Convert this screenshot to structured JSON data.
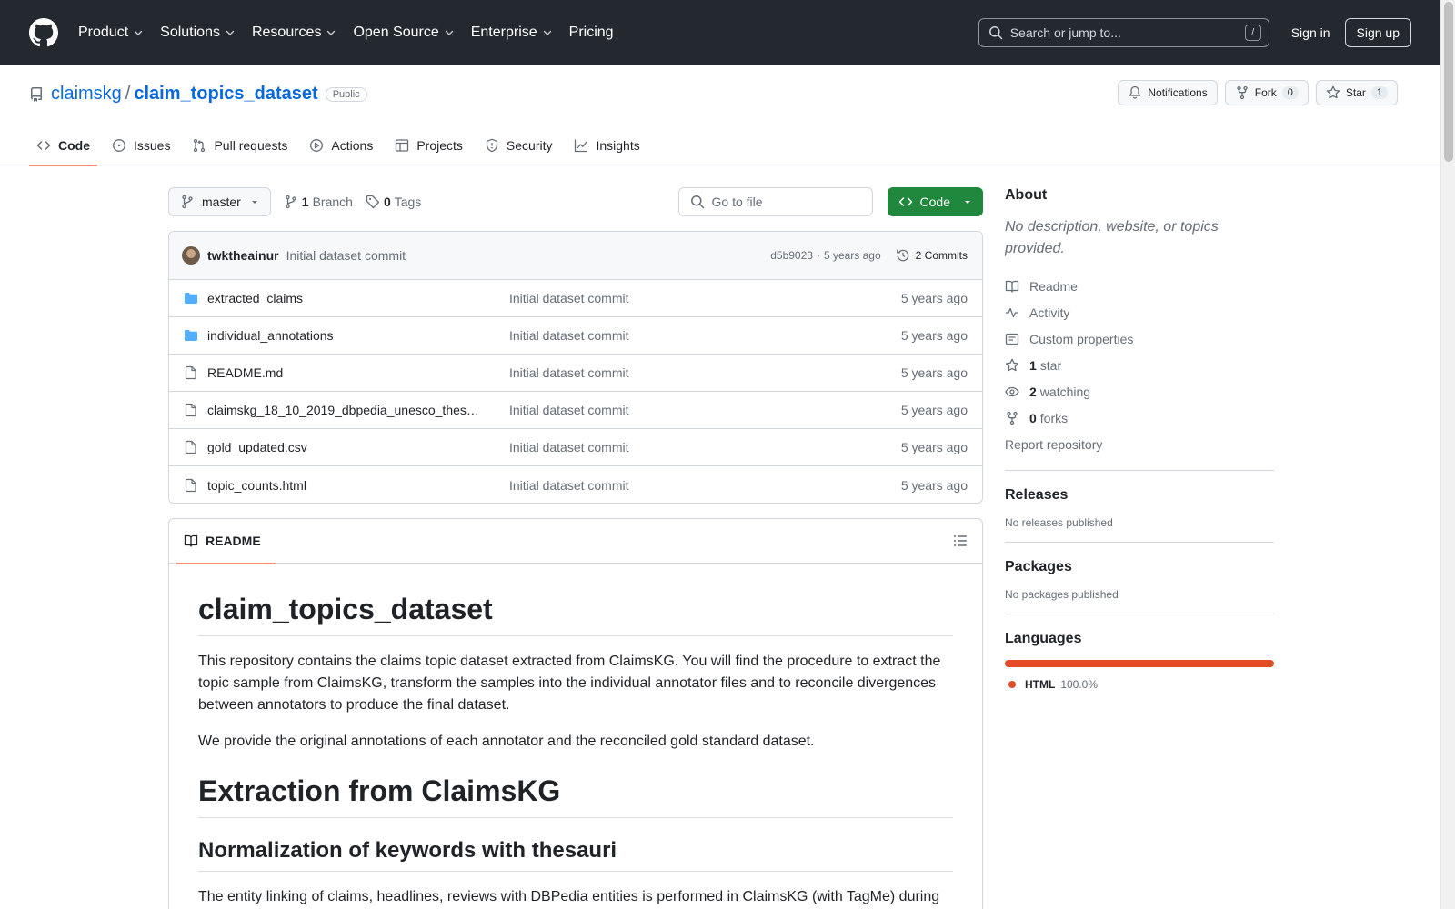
{
  "colors": {
    "header_bg": "#24292f",
    "link": "#0969da",
    "green": "#1f883d",
    "tab_underline": "#fd8c73",
    "html_lang": "#e34c26"
  },
  "top_nav": {
    "items": [
      {
        "label": "Product",
        "dropdown": true
      },
      {
        "label": "Solutions",
        "dropdown": true
      },
      {
        "label": "Resources",
        "dropdown": true
      },
      {
        "label": "Open Source",
        "dropdown": true
      },
      {
        "label": "Enterprise",
        "dropdown": true
      },
      {
        "label": "Pricing",
        "dropdown": false
      }
    ],
    "search_placeholder": "Search or jump to...",
    "search_shortcut": "/",
    "sign_in": "Sign in",
    "sign_up": "Sign up"
  },
  "repo": {
    "owner": "claimskg",
    "separator": "/",
    "name": "claim_topics_dataset",
    "visibility": "Public",
    "notifications_label": "Notifications",
    "fork_label": "Fork",
    "fork_count": "0",
    "star_label": "Star",
    "star_count": "1"
  },
  "tabs": [
    {
      "label": "Code",
      "icon": "code-icon",
      "selected": true
    },
    {
      "label": "Issues",
      "icon": "issue-icon",
      "selected": false
    },
    {
      "label": "Pull requests",
      "icon": "pull-request-icon",
      "selected": false
    },
    {
      "label": "Actions",
      "icon": "play-icon",
      "selected": false
    },
    {
      "label": "Projects",
      "icon": "table-icon",
      "selected": false
    },
    {
      "label": "Security",
      "icon": "shield-icon",
      "selected": false
    },
    {
      "label": "Insights",
      "icon": "graph-icon",
      "selected": false
    }
  ],
  "toolbar": {
    "branch": "master",
    "branch_count": "1",
    "branch_label": "Branch",
    "tag_count": "0",
    "tag_label": "Tags",
    "go_to_file": "Go to file",
    "code_button": "Code"
  },
  "commit": {
    "author": "twktheainur",
    "message": "Initial dataset commit",
    "hash": "d5b9023",
    "dot": "·",
    "age": "5 years ago",
    "commits_label": "2 Commits"
  },
  "files": [
    {
      "type": "folder",
      "name": "extracted_claims",
      "message": "Initial dataset commit",
      "age": "5 years ago"
    },
    {
      "type": "folder",
      "name": "individual_annotations",
      "message": "Initial dataset commit",
      "age": "5 years ago"
    },
    {
      "type": "file",
      "name": "README.md",
      "message": "Initial dataset commit",
      "age": "5 years ago"
    },
    {
      "type": "file",
      "name": "claimskg_18_10_2019_dbpedia_unesco_thes…",
      "message": "Initial dataset commit",
      "age": "5 years ago"
    },
    {
      "type": "file",
      "name": "gold_updated.csv",
      "message": "Initial dataset commit",
      "age": "5 years ago"
    },
    {
      "type": "file",
      "name": "topic_counts.html",
      "message": "Initial dataset commit",
      "age": "5 years ago"
    }
  ],
  "readme": {
    "tab_label": "README",
    "h1": "claim_topics_dataset",
    "p1": "This repository contains the claims topic dataset extracted from ClaimsKG. You will find the procedure to extract the topic sample from ClaimsKG, transform the samples into the individual annotator files and to reconcile divergences between annotators to produce the final dataset.",
    "p2": "We provide the original annotations of each annotator and the reconciled gold standard dataset.",
    "h1b": "Extraction from ClaimsKG",
    "h2": "Normalization of keywords with thesauri",
    "p3": "The entity linking of claims, headlines, reviews with DBPedia entities is performed in ClaimsKG (with TagMe) during"
  },
  "about": {
    "heading": "About",
    "description": "No description, website, or topics provided.",
    "links": [
      {
        "icon": "book-icon",
        "count": "",
        "label": "Readme"
      },
      {
        "icon": "pulse-icon",
        "count": "",
        "label": "Activity"
      },
      {
        "icon": "note-icon",
        "count": "",
        "label": "Custom properties"
      },
      {
        "icon": "star-icon",
        "count": "1",
        "label": "star"
      },
      {
        "icon": "eye-icon",
        "count": "2",
        "label": "watching"
      },
      {
        "icon": "fork-icon",
        "count": "0",
        "label": "forks"
      }
    ],
    "report": "Report repository"
  },
  "releases": {
    "heading": "Releases",
    "empty": "No releases published"
  },
  "packages": {
    "heading": "Packages",
    "empty": "No packages published"
  },
  "languages": {
    "heading": "Languages",
    "items": [
      {
        "name": "HTML",
        "percent": "100.0%",
        "fraction": 1.0
      }
    ]
  }
}
